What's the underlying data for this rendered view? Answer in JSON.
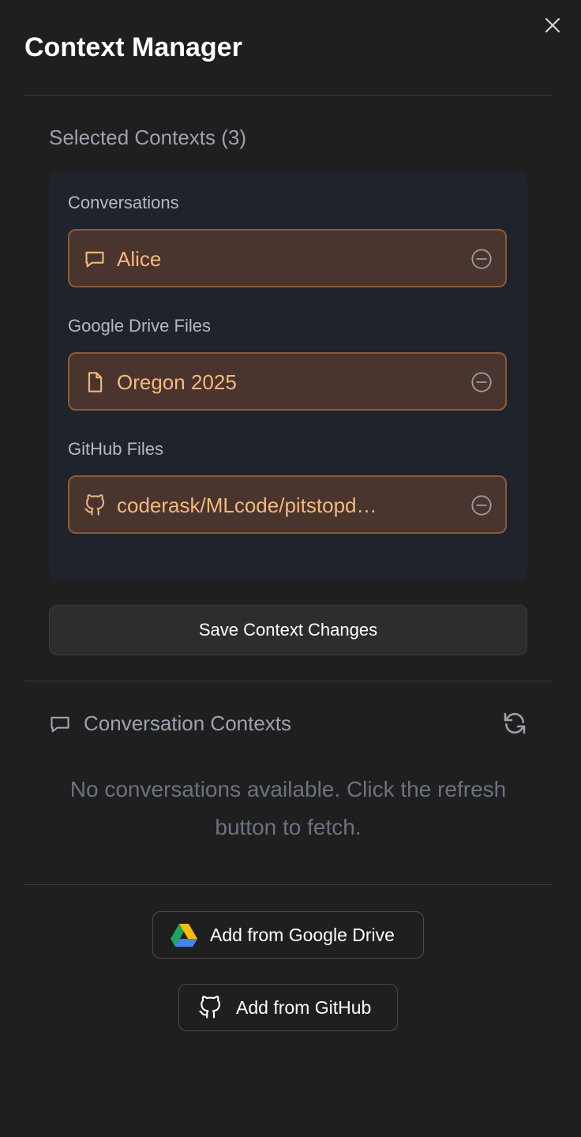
{
  "header": {
    "title": "Context Manager",
    "close_icon": "close-icon"
  },
  "selected": {
    "heading": "Selected Contexts (3)",
    "groups": [
      {
        "label": "Conversations",
        "items": [
          {
            "icon": "chat-bubble-icon",
            "label": "Alice"
          }
        ]
      },
      {
        "label": "Google Drive Files",
        "items": [
          {
            "icon": "file-icon",
            "label": "Oregon 2025"
          }
        ]
      },
      {
        "label": "GitHub Files",
        "items": [
          {
            "icon": "github-icon",
            "label": "coderask/MLcode/pitstopd…"
          }
        ]
      }
    ],
    "remove_icon": "minus-circle-icon",
    "save_label": "Save Context Changes"
  },
  "conversations": {
    "icon": "chat-bubble-icon",
    "heading": "Conversation Contexts",
    "refresh_icon": "refresh-icon",
    "empty_message": "No conversations available. Click the refresh button to fetch."
  },
  "actions": {
    "google_drive_label": "Add from Google Drive",
    "github_label": "Add from GitHub"
  },
  "colors": {
    "background": "#1f1f1f",
    "chip_bg": "#4a352e",
    "chip_border": "#8a5a3a",
    "chip_text": "#f5b87a",
    "contexts_box_bg": "#1f232c"
  }
}
